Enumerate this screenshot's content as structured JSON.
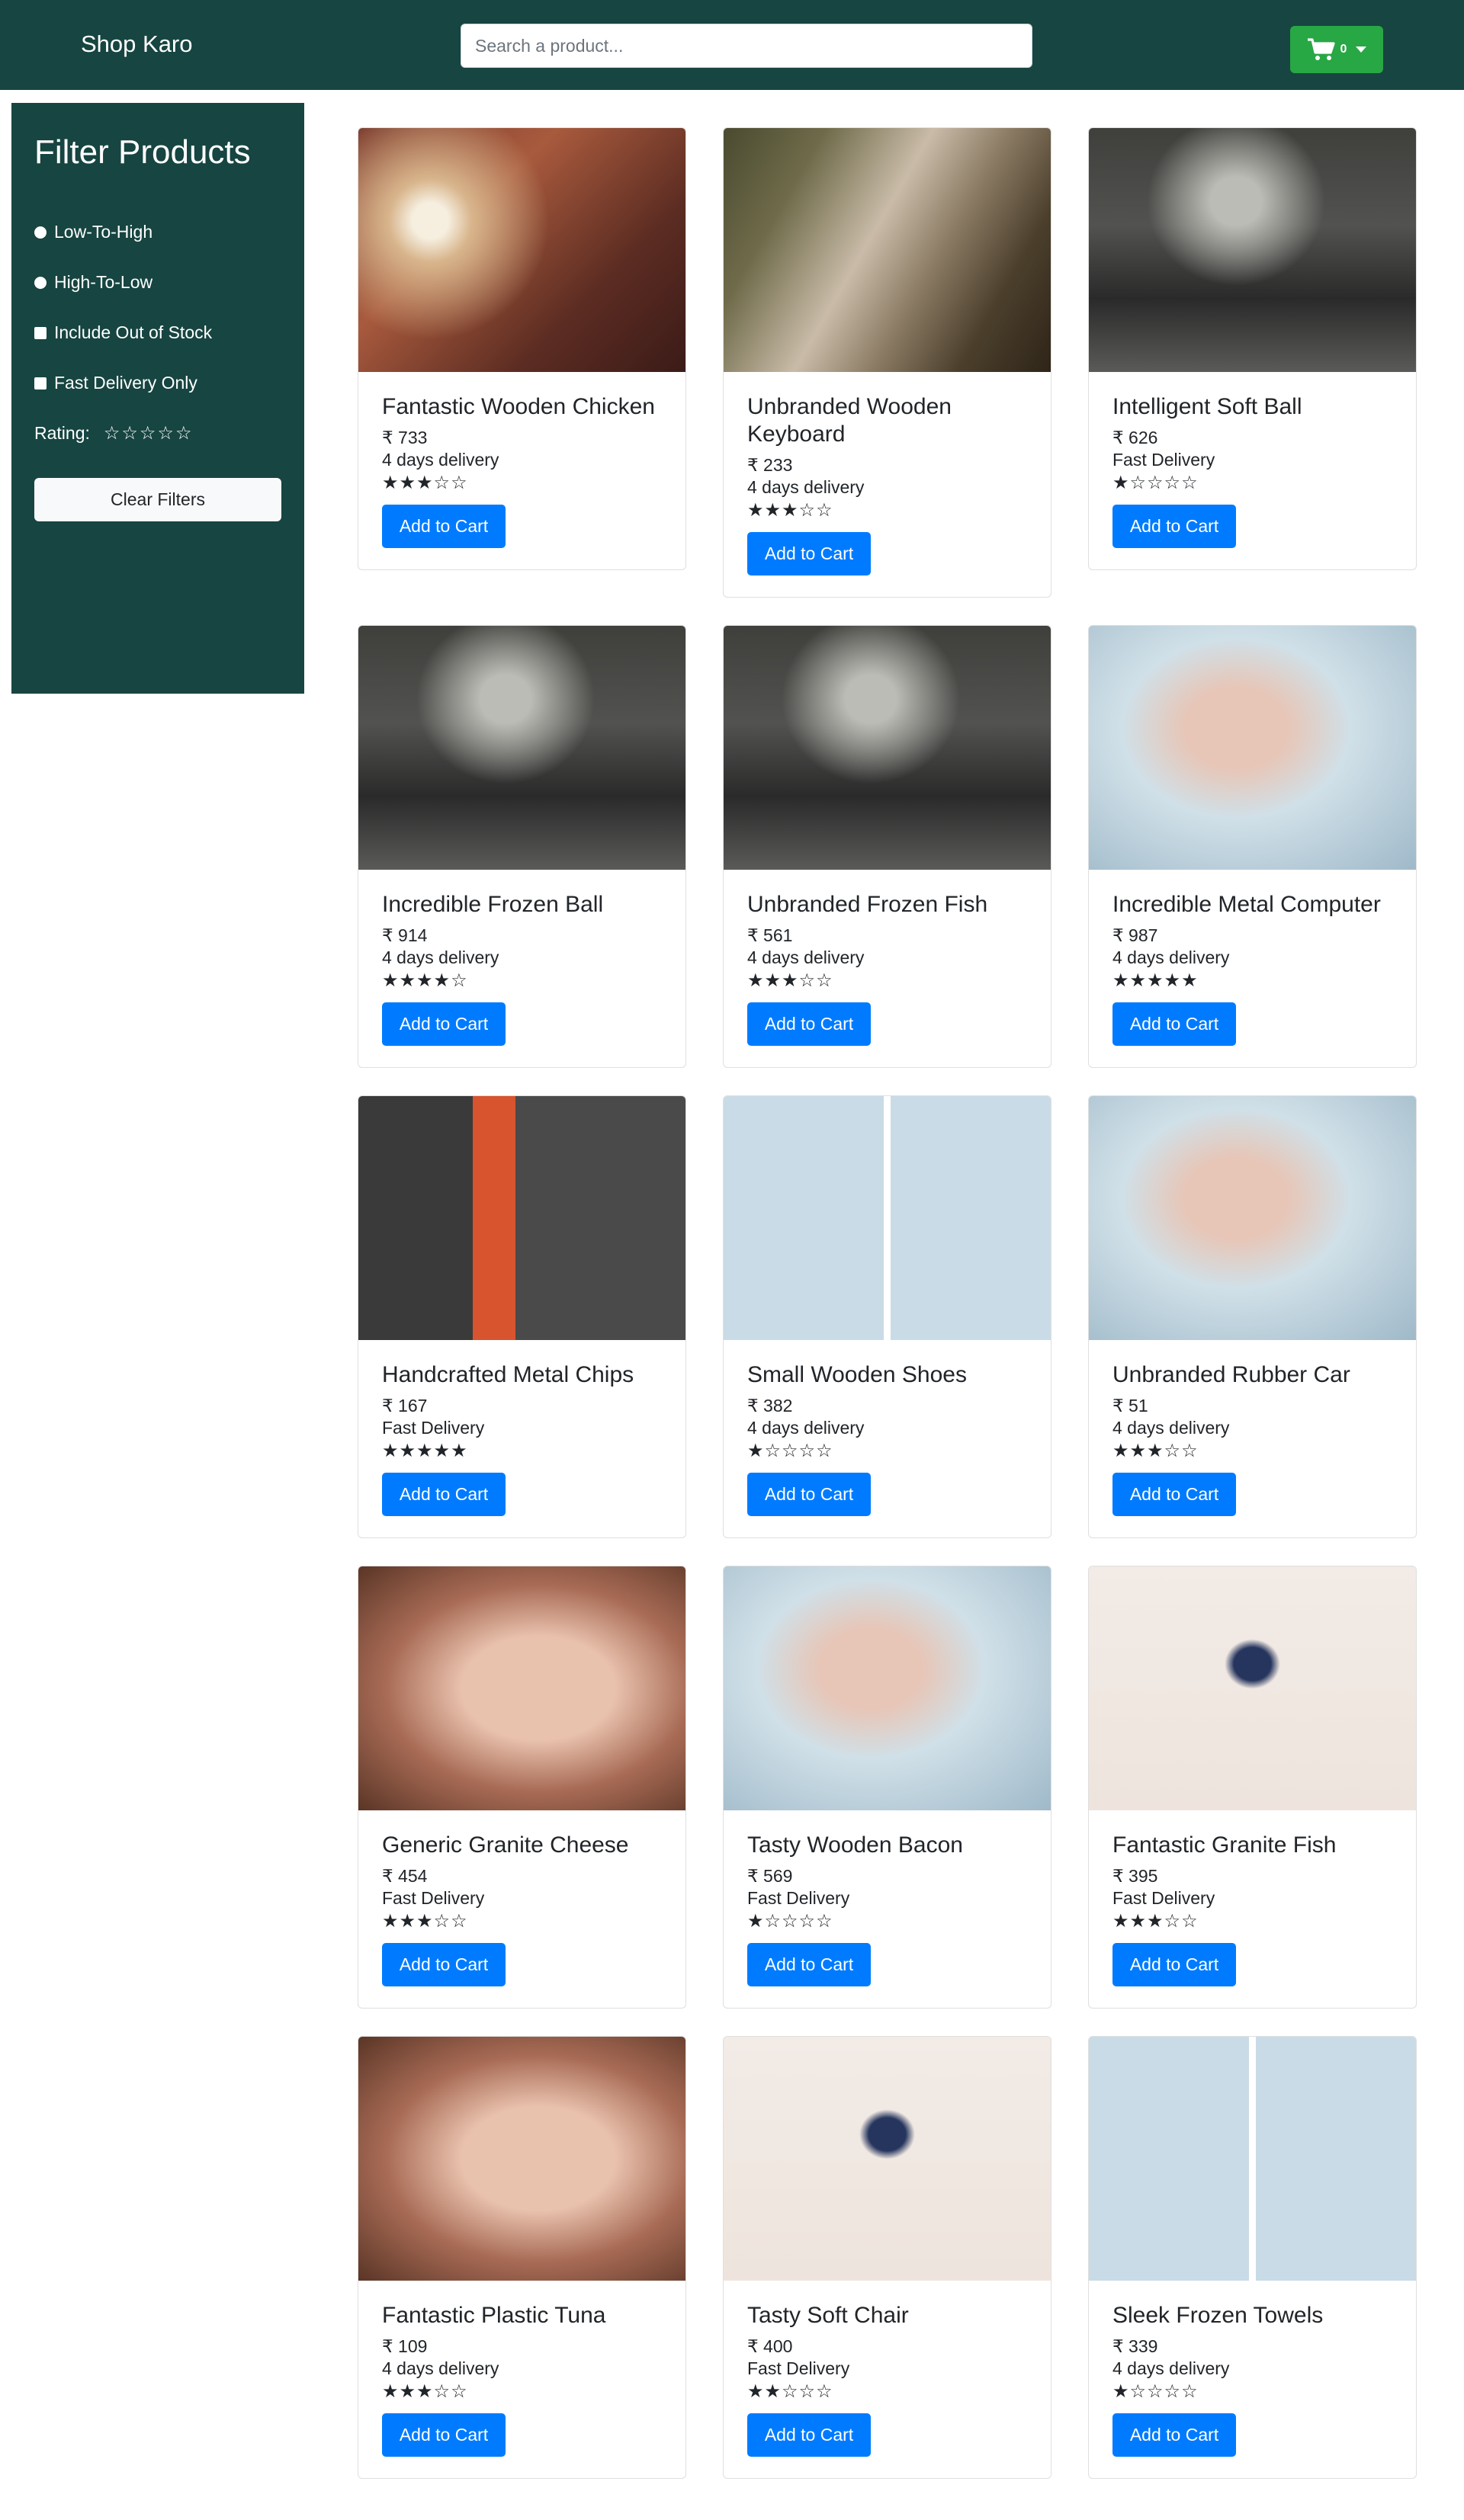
{
  "header": {
    "brand": "Shop Karo",
    "search_placeholder": "Search a product...",
    "cart_count": "0",
    "bg_color": "#174541",
    "cart_color": "#28a745"
  },
  "sidebar": {
    "title": "Filter Products",
    "options": {
      "low_to_high": "Low-To-High",
      "high_to_low": "High-To-Low",
      "include_out_of_stock": "Include Out of Stock",
      "fast_delivery_only": "Fast Delivery Only"
    },
    "rating_label": "Rating:",
    "clear_label": "Clear Filters"
  },
  "products": [
    {
      "name": "Fantastic Wooden Chicken",
      "price": "₹ 733",
      "delivery": "4 days delivery",
      "rating": 3,
      "image": "branch"
    },
    {
      "name": "Unbranded Wooden Keyboard",
      "price": "₹ 233",
      "delivery": "4 days delivery",
      "rating": 3,
      "image": "rock"
    },
    {
      "name": "Intelligent Soft Ball",
      "price": "₹ 626",
      "delivery": "Fast Delivery",
      "rating": 1,
      "image": "corridor"
    },
    {
      "name": "Incredible Frozen Ball",
      "price": "₹ 914",
      "delivery": "4 days delivery",
      "rating": 4,
      "image": "corridor"
    },
    {
      "name": "Unbranded Frozen Fish",
      "price": "₹ 561",
      "delivery": "4 days delivery",
      "rating": 3,
      "image": "corridor"
    },
    {
      "name": "Incredible Metal Computer",
      "price": "₹ 987",
      "delivery": "4 days delivery",
      "rating": 5,
      "image": "blonde"
    },
    {
      "name": "Handcrafted Metal Chips",
      "price": "₹ 167",
      "delivery": "Fast Delivery",
      "rating": 5,
      "image": "street"
    },
    {
      "name": "Small Wooden Shoes",
      "price": "₹ 382",
      "delivery": "4 days delivery",
      "rating": 1,
      "image": "twin"
    },
    {
      "name": "Unbranded Rubber Car",
      "price": "₹ 51",
      "delivery": "4 days delivery",
      "rating": 3,
      "image": "blonde"
    },
    {
      "name": "Generic Granite Cheese",
      "price": "₹ 454",
      "delivery": "Fast Delivery",
      "rating": 3,
      "image": "face"
    },
    {
      "name": "Tasty Wooden Bacon",
      "price": "₹ 569",
      "delivery": "Fast Delivery",
      "rating": 1,
      "image": "blonde"
    },
    {
      "name": "Fantastic Granite Fish",
      "price": "₹ 395",
      "delivery": "Fast Delivery",
      "rating": 3,
      "image": "jump"
    },
    {
      "name": "Fantastic Plastic Tuna",
      "price": "₹ 109",
      "delivery": "4 days delivery",
      "rating": 3,
      "image": "face"
    },
    {
      "name": "Tasty Soft Chair",
      "price": "₹ 400",
      "delivery": "Fast Delivery",
      "rating": 2,
      "image": "jump"
    },
    {
      "name": "Sleek Frozen Towels",
      "price": "₹ 339",
      "delivery": "4 days delivery",
      "rating": 1,
      "image": "twin"
    }
  ],
  "add_to_cart_label": "Add to Cart",
  "button_color": "#007bff"
}
